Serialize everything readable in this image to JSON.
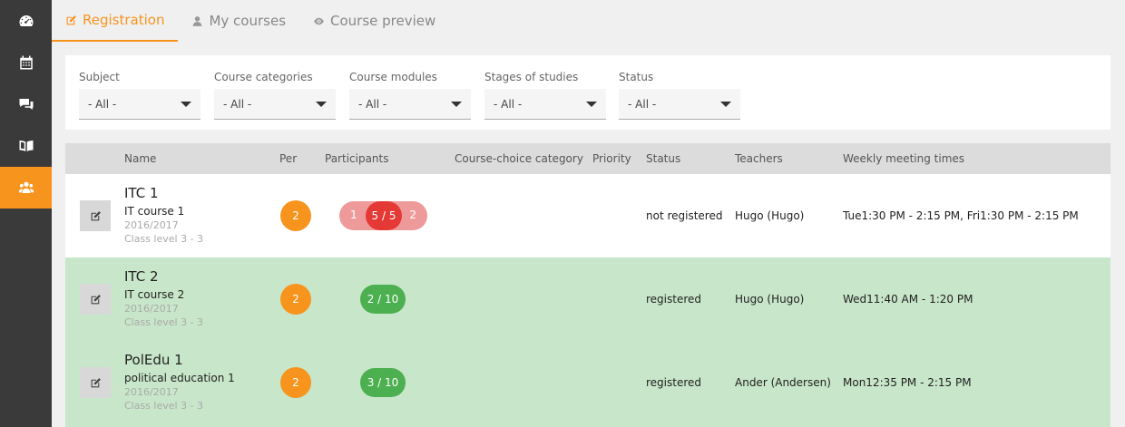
{
  "sidebar": {
    "items": [
      {
        "icon": "dashboard-icon",
        "active": false
      },
      {
        "icon": "calendar-icon",
        "active": false
      },
      {
        "icon": "chat-icon",
        "active": false
      },
      {
        "icon": "book-icon",
        "active": false
      },
      {
        "icon": "users-icon",
        "active": true
      }
    ]
  },
  "tabs": [
    {
      "label": "Registration",
      "icon": "edit-icon",
      "active": true
    },
    {
      "label": "My courses",
      "icon": "user-icon",
      "active": false
    },
    {
      "label": "Course preview",
      "icon": "eye-icon",
      "active": false
    }
  ],
  "filters": [
    {
      "label": "Subject",
      "value": "- All -"
    },
    {
      "label": "Course categories",
      "value": "- All -"
    },
    {
      "label": "Course modules",
      "value": "- All -"
    },
    {
      "label": "Stages of studies",
      "value": "- All -"
    },
    {
      "label": "Status",
      "value": "- All -"
    }
  ],
  "table": {
    "headers": {
      "name": "Name",
      "per": "Per",
      "participants": "Participants",
      "category": "Course-choice category",
      "priority": "Priority",
      "status": "Status",
      "teachers": "Teachers",
      "times": "Weekly meeting times"
    },
    "rows": [
      {
        "title": "ITC 1",
        "subtitle": "IT course 1",
        "year": "2016/2017",
        "level": "Class level 3 - 3",
        "per": "2",
        "participants": {
          "left": "1",
          "main": "5 / 5",
          "right": "2"
        },
        "status": "not registered",
        "teachers": "Hugo (Hugo)",
        "times": "Tue1:30 PM - 2:15 PM, Fri1:30 PM - 2:15 PM"
      },
      {
        "title": "ITC 2",
        "subtitle": "IT course 2",
        "year": "2016/2017",
        "level": "Class level 3 - 3",
        "per": "2",
        "participants": {
          "main": "2 / 10"
        },
        "status": "registered",
        "teachers": "Hugo (Hugo)",
        "times": "Wed11:40 AM - 1:20 PM"
      },
      {
        "title": "PolEdu 1",
        "subtitle": "political education 1",
        "year": "2016/2017",
        "level": "Class level 3 - 3",
        "per": "2",
        "participants": {
          "main": "3 / 10"
        },
        "status": "registered",
        "teachers": "Ander (Andersen)",
        "times": "Mon12:35 PM - 2:15 PM"
      }
    ]
  },
  "colors": {
    "accent": "#f7941d",
    "registered_row": "#c8e6c9",
    "full_course": "#e53935",
    "available_course": "#4caf50"
  }
}
